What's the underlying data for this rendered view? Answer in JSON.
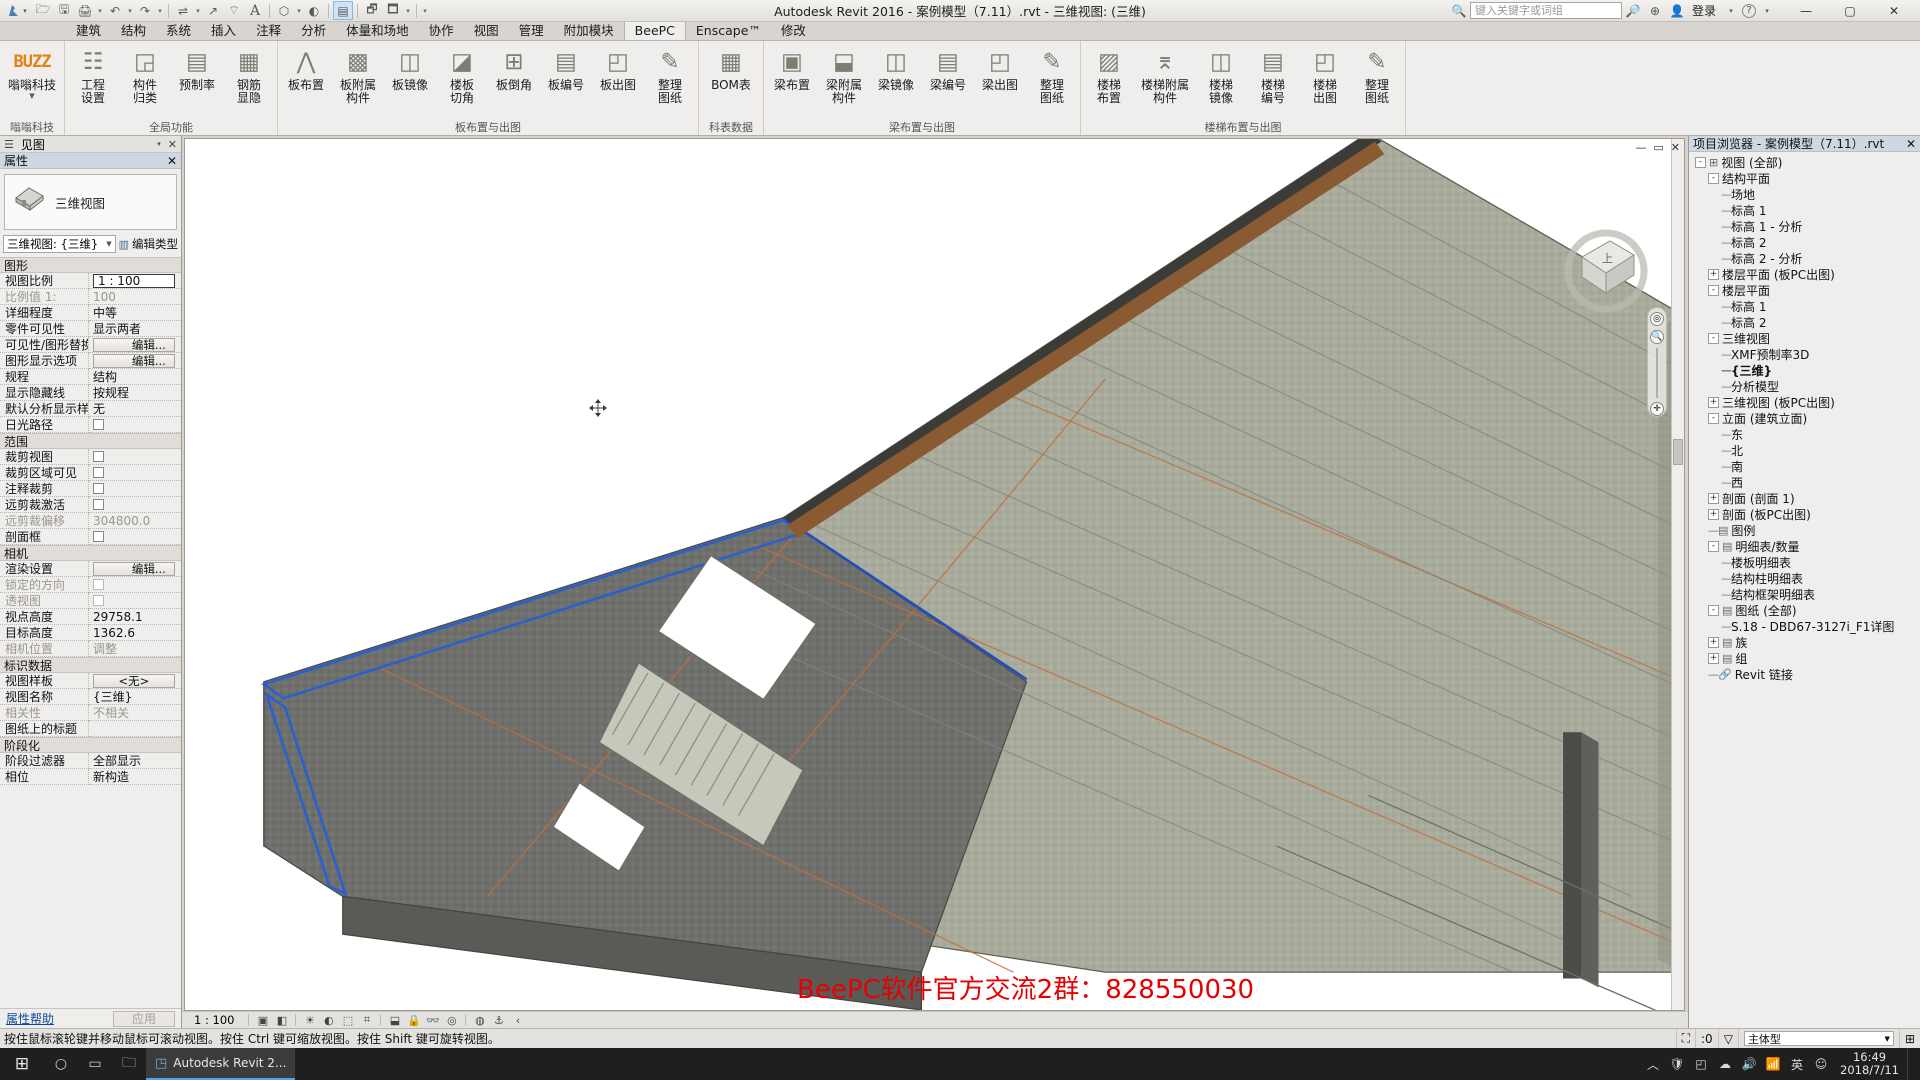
{
  "titlebar": {
    "app_title": "Autodesk Revit 2016 -   案例模型（7.11）.rvt - 三维视图: (三维)",
    "search_placeholder": "键入关键字或词组",
    "signin_label": "登录",
    "quick_access": [
      {
        "name": "open-icon",
        "glyph": "🗁"
      },
      {
        "name": "save-icon",
        "glyph": "🖫"
      },
      {
        "name": "print-icon",
        "glyph": "🖨"
      },
      {
        "name": "undo-icon",
        "glyph": "↶"
      },
      {
        "name": "redo-icon",
        "glyph": "↷"
      },
      {
        "name": "measure-icon",
        "glyph": "⇌"
      },
      {
        "name": "dimension-icon",
        "glyph": "↗"
      },
      {
        "name": "tag-icon",
        "glyph": "⌔"
      },
      {
        "name": "text-icon",
        "glyph": "A"
      },
      {
        "name": "3dview-icon",
        "glyph": "⬡"
      },
      {
        "name": "section-icon",
        "glyph": "◐"
      },
      {
        "name": "sheet-list-icon",
        "glyph": "▤"
      },
      {
        "name": "close-hidden-icon",
        "glyph": "🗗"
      },
      {
        "name": "switch-window-icon",
        "glyph": "🗖"
      }
    ],
    "win_minimize": "—",
    "win_maximize": "▢",
    "win_close": "✕",
    "help_icon": "?",
    "dropdown_icon": "▾"
  },
  "ribbon": {
    "tabs": [
      {
        "label": "建筑",
        "active": false
      },
      {
        "label": "结构",
        "active": false
      },
      {
        "label": "系统",
        "active": false
      },
      {
        "label": "插入",
        "active": false
      },
      {
        "label": "注释",
        "active": false
      },
      {
        "label": "分析",
        "active": false
      },
      {
        "label": "体量和场地",
        "active": false
      },
      {
        "label": "协作",
        "active": false
      },
      {
        "label": "视图",
        "active": false
      },
      {
        "label": "管理",
        "active": false
      },
      {
        "label": "附加模块",
        "active": false
      },
      {
        "label": "BeePC",
        "active": true
      },
      {
        "label": "Enscape™",
        "active": false
      },
      {
        "label": "修改",
        "active": false
      }
    ],
    "panels": [
      {
        "title": "嗡嗡科技",
        "buttons": [
          {
            "name": "buzz-logo-button",
            "label": "嗡嗡科技",
            "label2": "",
            "icon": "BUZZ",
            "dropdown": true
          }
        ]
      },
      {
        "title": "全局功能",
        "buttons": [
          {
            "name": "project-settings-button",
            "label": "工程",
            "label2": "设置",
            "icon": "☷"
          },
          {
            "name": "component-classify-button",
            "label": "构件",
            "label2": "归类",
            "icon": "◲"
          },
          {
            "name": "prefab-rate-button",
            "label": "预制率",
            "label2": "",
            "icon": "▤"
          },
          {
            "name": "rebar-hide-button",
            "label": "钢筋",
            "label2": "显隐",
            "icon": "▦"
          }
        ]
      },
      {
        "title": "板布置与出图",
        "buttons": [
          {
            "name": "slab-layout-button",
            "label": "板布置",
            "label2": "",
            "icon": "⋀"
          },
          {
            "name": "slab-attached-parts-button",
            "label": "板附属",
            "label2": "构件",
            "icon": "▩"
          },
          {
            "name": "slab-mirror-button",
            "label": "板镜像",
            "label2": "",
            "icon": "◫"
          },
          {
            "name": "slab-corner-cut-button",
            "label": "楼板",
            "label2": "切角",
            "icon": "◪"
          },
          {
            "name": "slab-chamfer-button",
            "label": "板倒角",
            "label2": "",
            "icon": "⊞"
          },
          {
            "name": "slab-number-button",
            "label": "板编号",
            "label2": "",
            "icon": "▤"
          },
          {
            "name": "slab-drawing-button",
            "label": "板出图",
            "label2": "",
            "icon": "◰"
          },
          {
            "name": "slab-organize-sheets-button",
            "label": "整理",
            "label2": "图纸",
            "icon": "✎"
          }
        ]
      },
      {
        "title": "科表数据",
        "buttons": [
          {
            "name": "bom-table-button",
            "label": "BOM表",
            "label2": "",
            "icon": "▦"
          }
        ]
      },
      {
        "title": "梁布置与出图",
        "buttons": [
          {
            "name": "beam-layout-button",
            "label": "梁布置",
            "label2": "",
            "icon": "▣"
          },
          {
            "name": "beam-attached-parts-button",
            "label": "梁附属",
            "label2": "构件",
            "icon": "⬓"
          },
          {
            "name": "beam-mirror-button",
            "label": "梁镜像",
            "label2": "",
            "icon": "◫"
          },
          {
            "name": "beam-number-button",
            "label": "梁编号",
            "label2": "",
            "icon": "▤"
          },
          {
            "name": "beam-drawing-button",
            "label": "梁出图",
            "label2": "",
            "icon": "◰"
          },
          {
            "name": "beam-organize-sheets-button",
            "label": "整理",
            "label2": "图纸",
            "icon": "✎"
          }
        ]
      },
      {
        "title": "楼梯布置与出图",
        "buttons": [
          {
            "name": "stair-layout-button",
            "label": "楼梯",
            "label2": "布置",
            "icon": "▨"
          },
          {
            "name": "stair-attached-parts-button",
            "label": "楼梯附属",
            "label2": "构件",
            "icon": "⌆"
          },
          {
            "name": "stair-mirror-button",
            "label": "楼梯",
            "label2": "镜像",
            "icon": "◫"
          },
          {
            "name": "stair-number-button",
            "label": "楼梯",
            "label2": "编号",
            "icon": "▤"
          },
          {
            "name": "stair-drawing-button",
            "label": "楼梯",
            "label2": "出图",
            "icon": "◰"
          },
          {
            "name": "stair-organize-sheets-button",
            "label": "整理",
            "label2": "图纸",
            "icon": "✎"
          }
        ]
      }
    ]
  },
  "viewbar": {
    "icon": "☰",
    "label": "见图",
    "close": "✕"
  },
  "properties": {
    "header": "属性",
    "close": "✕",
    "type_icon": "house-icon",
    "type_name": "三维视图",
    "selector_value": "三维视图: {三维}",
    "edit_type_label": "编辑类型",
    "footer_help": "属性帮助",
    "apply_label": "应用",
    "groups": [
      {
        "name": "图形",
        "rows": [
          {
            "key": "视图比例",
            "value": "1 : 100",
            "kind": "textbox"
          },
          {
            "key": "比例值 1:",
            "value": "100",
            "kind": "text",
            "dim": true
          },
          {
            "key": "详细程度",
            "value": "中等",
            "kind": "text"
          },
          {
            "key": "零件可见性",
            "value": "显示两者",
            "kind": "text"
          },
          {
            "key": "可见性/图形替换",
            "value": "编辑...",
            "kind": "button"
          },
          {
            "key": "图形显示选项",
            "value": "编辑...",
            "kind": "button"
          },
          {
            "key": "规程",
            "value": "结构",
            "kind": "text"
          },
          {
            "key": "显示隐藏线",
            "value": "按规程",
            "kind": "text"
          },
          {
            "key": "默认分析显示样式",
            "value": "无",
            "kind": "text"
          },
          {
            "key": "日光路径",
            "value": "",
            "kind": "checkbox"
          }
        ]
      },
      {
        "name": "范围",
        "rows": [
          {
            "key": "裁剪视图",
            "value": "",
            "kind": "checkbox"
          },
          {
            "key": "裁剪区域可见",
            "value": "",
            "kind": "checkbox"
          },
          {
            "key": "注释裁剪",
            "value": "",
            "kind": "checkbox"
          },
          {
            "key": "远剪裁激活",
            "value": "",
            "kind": "checkbox"
          },
          {
            "key": "远剪裁偏移",
            "value": "304800.0",
            "kind": "text",
            "dim": true
          },
          {
            "key": "剖面框",
            "value": "",
            "kind": "checkbox"
          }
        ]
      },
      {
        "name": "相机",
        "rows": [
          {
            "key": "渲染设置",
            "value": "编辑...",
            "kind": "button"
          },
          {
            "key": "锁定的方向",
            "value": "",
            "kind": "checkbox",
            "dim": true
          },
          {
            "key": "透视图",
            "value": "",
            "kind": "checkbox",
            "dim": true
          },
          {
            "key": "视点高度",
            "value": "29758.1",
            "kind": "text"
          },
          {
            "key": "目标高度",
            "value": "1362.6",
            "kind": "text"
          },
          {
            "key": "相机位置",
            "value": "调整",
            "kind": "text",
            "dim": true
          }
        ]
      },
      {
        "name": "标识数据",
        "rows": [
          {
            "key": "视图样板",
            "value": "<无>",
            "kind": "button-center"
          },
          {
            "key": "视图名称",
            "value": "{三维}",
            "kind": "text"
          },
          {
            "key": "相关性",
            "value": "不相关",
            "kind": "text",
            "dim": true
          },
          {
            "key": "图纸上的标题",
            "value": "",
            "kind": "text"
          }
        ]
      },
      {
        "name": "阶段化",
        "rows": [
          {
            "key": "阶段过滤器",
            "value": "全部显示",
            "kind": "text"
          },
          {
            "key": "相位",
            "value": "新构造",
            "kind": "text"
          }
        ]
      }
    ]
  },
  "viewport": {
    "minimize": "—",
    "maximize": "▭",
    "close": "✕",
    "watermark": "BeePC软件官方交流2群：828550030",
    "navcube_name": "view-cube"
  },
  "view_control_bar": {
    "scale": "1 : 100",
    "icons": [
      {
        "name": "detail-level-icon",
        "glyph": "▣"
      },
      {
        "name": "visual-style-icon",
        "glyph": "◧"
      },
      {
        "name": "sun-path-icon",
        "glyph": "☀"
      },
      {
        "name": "shadows-icon",
        "glyph": "◐"
      },
      {
        "name": "render-icon",
        "glyph": "⬚"
      },
      {
        "name": "crop-view-icon",
        "glyph": "⌗"
      },
      {
        "name": "show-crop-icon",
        "glyph": "⬓"
      },
      {
        "name": "lock-3d-icon",
        "glyph": "🔒"
      },
      {
        "name": "temp-hide-icon",
        "glyph": "👓"
      },
      {
        "name": "reveal-hidden-icon",
        "glyph": "◎"
      },
      {
        "name": "analytical-model-icon",
        "glyph": "◍"
      },
      {
        "name": "constraints-icon",
        "glyph": "⚓"
      },
      {
        "name": "more-icon",
        "glyph": "‹"
      }
    ]
  },
  "browser": {
    "header": "项目浏览器 - 案例模型（7.11）.rvt",
    "close": "✕",
    "nodes": [
      {
        "label": "视图 (全部)",
        "depth": 0,
        "expander": "-",
        "icon": "⊞"
      },
      {
        "label": "结构平面",
        "depth": 1,
        "expander": "-",
        "icon": ""
      },
      {
        "label": "场地",
        "depth": 2,
        "expander": "",
        "icon": ""
      },
      {
        "label": "标高 1",
        "depth": 2,
        "expander": "",
        "icon": ""
      },
      {
        "label": "标高 1 - 分析",
        "depth": 2,
        "expander": "",
        "icon": ""
      },
      {
        "label": "标高 2",
        "depth": 2,
        "expander": "",
        "icon": ""
      },
      {
        "label": "标高 2 - 分析",
        "depth": 2,
        "expander": "",
        "icon": ""
      },
      {
        "label": "楼层平面 (板PC出图)",
        "depth": 1,
        "expander": "+",
        "icon": ""
      },
      {
        "label": "楼层平面",
        "depth": 1,
        "expander": "-",
        "icon": ""
      },
      {
        "label": "标高 1",
        "depth": 2,
        "expander": "",
        "icon": ""
      },
      {
        "label": "标高 2",
        "depth": 2,
        "expander": "",
        "icon": ""
      },
      {
        "label": "三维视图",
        "depth": 1,
        "expander": "-",
        "icon": ""
      },
      {
        "label": "XMF预制率3D",
        "depth": 2,
        "expander": "",
        "icon": ""
      },
      {
        "label": "{三维}",
        "depth": 2,
        "expander": "",
        "icon": "",
        "bold": true
      },
      {
        "label": "分析模型",
        "depth": 2,
        "expander": "",
        "icon": ""
      },
      {
        "label": "三维视图 (板PC出图)",
        "depth": 1,
        "expander": "+",
        "icon": ""
      },
      {
        "label": "立面 (建筑立面)",
        "depth": 1,
        "expander": "-",
        "icon": ""
      },
      {
        "label": "东",
        "depth": 2,
        "expander": "",
        "icon": ""
      },
      {
        "label": "北",
        "depth": 2,
        "expander": "",
        "icon": ""
      },
      {
        "label": "南",
        "depth": 2,
        "expander": "",
        "icon": ""
      },
      {
        "label": "西",
        "depth": 2,
        "expander": "",
        "icon": ""
      },
      {
        "label": "剖面 (剖面 1)",
        "depth": 1,
        "expander": "+",
        "icon": ""
      },
      {
        "label": "剖面 (板PC出图)",
        "depth": 1,
        "expander": "+",
        "icon": ""
      },
      {
        "label": "图例",
        "depth": 1,
        "expander": "",
        "icon": "▤"
      },
      {
        "label": "明细表/数量",
        "depth": 1,
        "expander": "-",
        "icon": "▤"
      },
      {
        "label": "楼板明细表",
        "depth": 2,
        "expander": "",
        "icon": ""
      },
      {
        "label": "结构柱明细表",
        "depth": 2,
        "expander": "",
        "icon": ""
      },
      {
        "label": "结构框架明细表",
        "depth": 2,
        "expander": "",
        "icon": ""
      },
      {
        "label": "图纸 (全部)",
        "depth": 1,
        "expander": "-",
        "icon": "▤"
      },
      {
        "label": "S.18 - DBD67-3127i_F1详图",
        "depth": 2,
        "expander": "",
        "icon": ""
      },
      {
        "label": "族",
        "depth": 1,
        "expander": "+",
        "icon": "▤"
      },
      {
        "label": "组",
        "depth": 1,
        "expander": "+",
        "icon": "▤"
      },
      {
        "label": "Revit 链接",
        "depth": 1,
        "expander": "",
        "icon": "🔗"
      }
    ]
  },
  "statusbar": {
    "hint": "按住鼠标滚轮键并移动鼠标可滚动视图。按住 Ctrl 键可缩放视图。按住 Shift 键可旋转视图。",
    "press_select_icon": "⛶",
    "filter_count": ":0",
    "model_label": "主体型",
    "filter_icon": "▽",
    "grid_icon": "⊞"
  },
  "taskbar": {
    "start_icon": "⊞",
    "search_icon": "○",
    "taskview_icon": "▭",
    "apps": [
      {
        "name": "taskbar-explorer",
        "glyph": "🗀"
      },
      {
        "name": "taskbar-revit",
        "glyph": "◳",
        "label": "Autodesk Revit 2..."
      }
    ],
    "tray": [
      {
        "name": "tray-chevron",
        "glyph": "︿"
      },
      {
        "name": "tray-defender",
        "glyph": "🛡"
      },
      {
        "name": "tray-network2",
        "glyph": "◰"
      },
      {
        "name": "tray-cloud",
        "glyph": "☁"
      },
      {
        "name": "tray-sound",
        "glyph": "🔊"
      },
      {
        "name": "tray-network",
        "glyph": "📶"
      },
      {
        "name": "tray-ime",
        "glyph": "英"
      },
      {
        "name": "tray-ime2",
        "glyph": "☺"
      }
    ],
    "clock_time": "16:49",
    "clock_date": "2018/7/11"
  }
}
